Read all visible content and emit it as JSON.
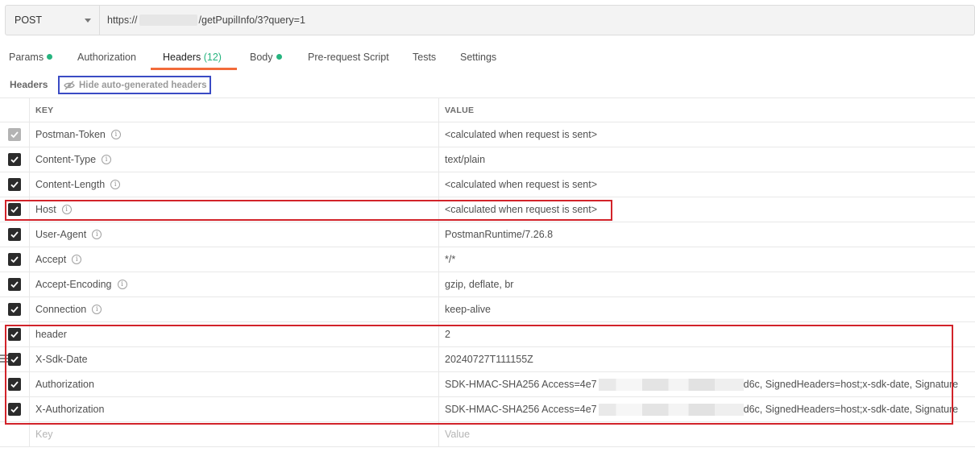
{
  "request": {
    "method": "POST",
    "url_prefix": "https://",
    "url_suffix": "/getPupilInfo/3?query=1"
  },
  "tabs": [
    {
      "label": "Params",
      "dot": true
    },
    {
      "label": "Authorization"
    },
    {
      "label": "Headers",
      "count": "(12)",
      "active": true
    },
    {
      "label": "Body",
      "dot": true
    },
    {
      "label": "Pre-request Script"
    },
    {
      "label": "Tests"
    },
    {
      "label": "Settings"
    }
  ],
  "headers_section": {
    "label": "Headers",
    "hide_button": "Hide auto-generated headers"
  },
  "table": {
    "col_key": "KEY",
    "col_value": "VALUE",
    "rows": [
      {
        "key": "Postman-Token",
        "value": "<calculated when request is sent>",
        "info": true,
        "disabled": true
      },
      {
        "key": "Content-Type",
        "value": "text/plain",
        "info": true
      },
      {
        "key": "Content-Length",
        "value": "<calculated when request is sent>",
        "info": true
      },
      {
        "key": "Host",
        "value": "<calculated when request is sent>",
        "info": true
      },
      {
        "key": "User-Agent",
        "value": "PostmanRuntime/7.26.8",
        "info": true
      },
      {
        "key": "Accept",
        "value": "*/*",
        "info": true
      },
      {
        "key": "Accept-Encoding",
        "value": "gzip, deflate, br",
        "info": true
      },
      {
        "key": "Connection",
        "value": "keep-alive",
        "info": true
      },
      {
        "key": "header",
        "value": "2"
      },
      {
        "key": "X-Sdk-Date",
        "value": "20240727T111155Z"
      },
      {
        "key": "Authorization",
        "value_prefix": "SDK-HMAC-SHA256 Access=4e7",
        "value_suffix": "d6c, SignedHeaders=host;x-sdk-date, Signature"
      },
      {
        "key": "X-Authorization",
        "value_prefix": "SDK-HMAC-SHA256 Access=4e7",
        "value_suffix": "d6c, SignedHeaders=host;x-sdk-date, Signature"
      }
    ],
    "new_key_placeholder": "Key",
    "new_value_placeholder": "Value"
  },
  "colors": {
    "accent": "#f26b3a",
    "status_dot": "#26b47f",
    "annotation_red": "#d2232a",
    "annotation_blue": "#3a4bc4"
  }
}
